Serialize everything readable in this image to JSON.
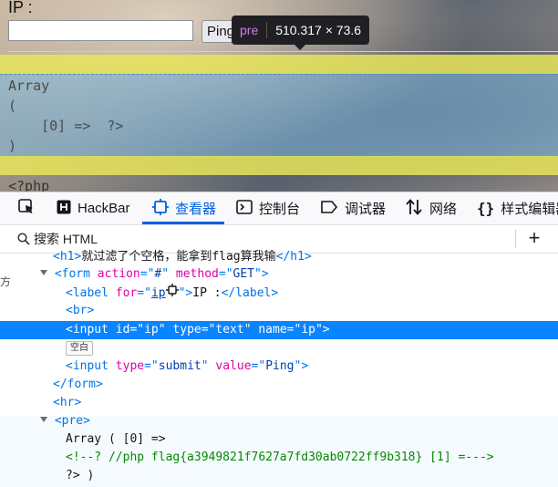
{
  "page": {
    "ip_label": "IP :",
    "ip_input_value": "",
    "ping_button": "Ping",
    "tooltip": {
      "tag": "pre",
      "size": "510.317 × 73.6"
    },
    "pre_lines": [
      "Array",
      "(",
      "    [0] =>  ?>",
      ")"
    ],
    "php_text": "<?php"
  },
  "devtools": {
    "tabs": [
      {
        "label": "",
        "icon": "element-picker-icon"
      },
      {
        "label": "HackBar",
        "icon": "hackbar-icon"
      },
      {
        "label": "查看器",
        "icon": "inspector-icon"
      },
      {
        "label": "控制台",
        "icon": "console-icon"
      },
      {
        "label": "调试器",
        "icon": "debugger-icon"
      },
      {
        "label": "网络",
        "icon": "network-icon"
      },
      {
        "label": "样式编辑器",
        "icon": "style-editor-icon"
      }
    ],
    "active_tab": "查看器",
    "accent_color": "#0061e0",
    "search_placeholder": "搜索 HTML",
    "add_label": "+",
    "left_edge_glyph": "方",
    "whitespace_badge": "空白",
    "tree": {
      "h1_text": "就过滤了个空格，能拿到flag算我输",
      "form": {
        "tag": "form",
        "action_attr": "action",
        "action_val": "#",
        "method_attr": "method",
        "method_val": "GET"
      },
      "label": {
        "tag": "label",
        "for_attr": "for",
        "for_val": "ip",
        "text": "IP :"
      },
      "br": "<br>",
      "input_ip": {
        "id_val": "ip",
        "type_val": "text",
        "name_val": "ip"
      },
      "input_submit": {
        "type_val": "submit",
        "value_val": "Ping"
      },
      "form_close": "</form>",
      "hr": "<hr>",
      "pre": "<pre>",
      "pre_text": "Array ( [0] =>",
      "comment": "<!--? //php flag{a3949821f7627a7fd30ab0722ff9b318} [1] =--->",
      "pre_tail": "?> )"
    }
  }
}
